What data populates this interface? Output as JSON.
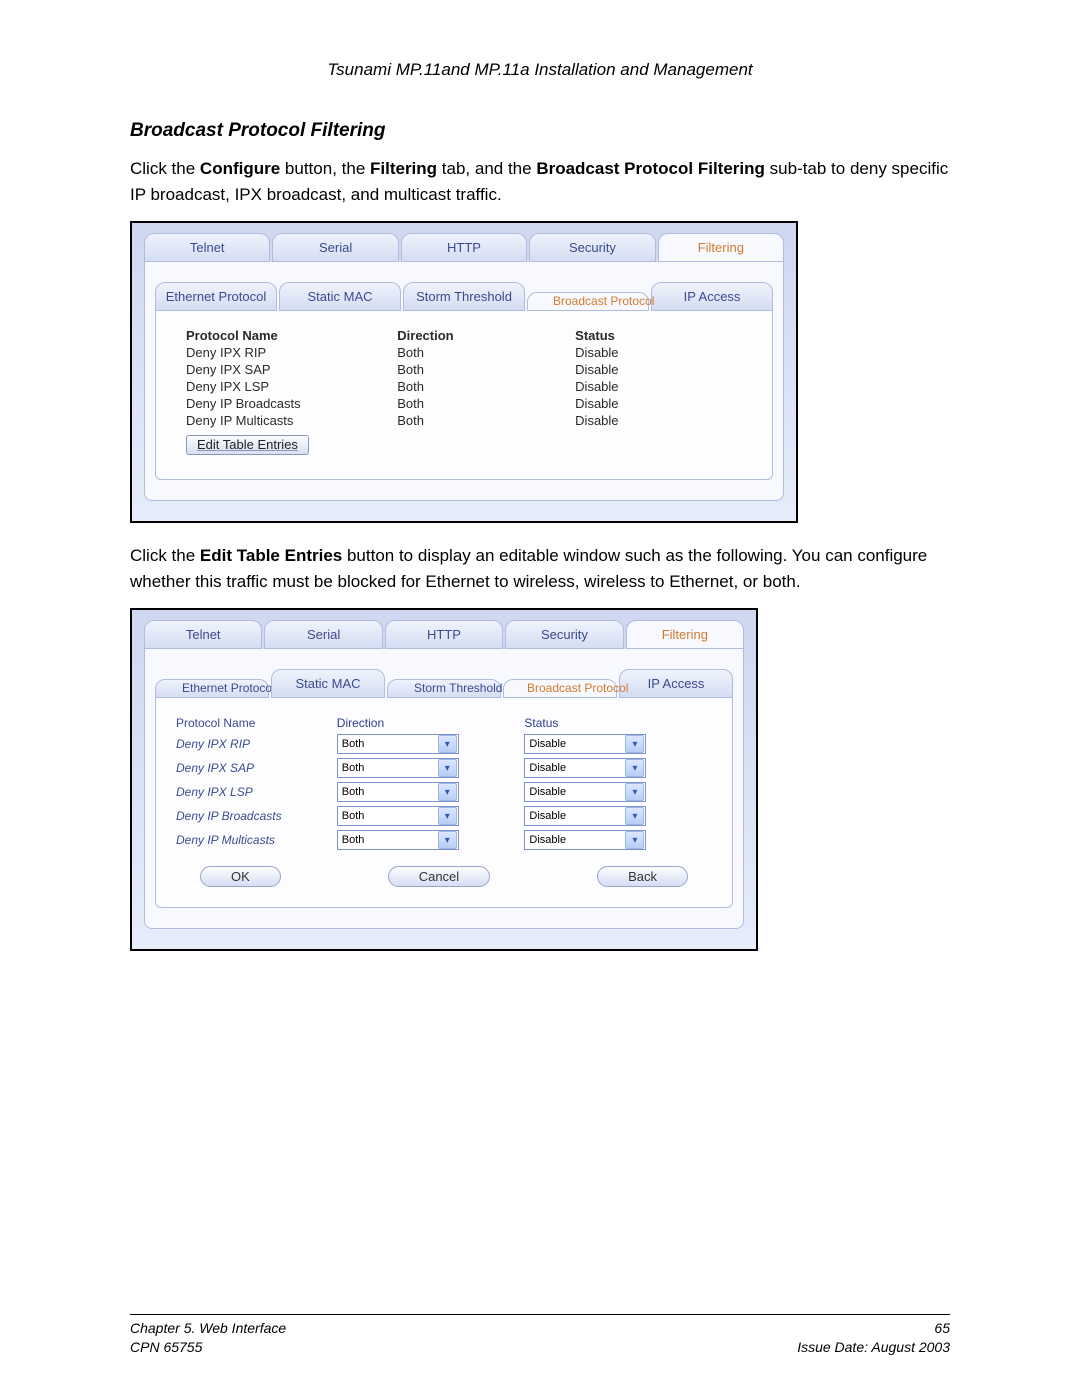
{
  "doc": {
    "header": "Tsunami MP.11and MP.11a Installation and Management",
    "section_title": "Broadcast Protocol Filtering",
    "para1_a": "Click the ",
    "para1_b": "Configure",
    "para1_c": " button, the ",
    "para1_d": "Filtering",
    "para1_e": " tab, and the ",
    "para1_f": "Broadcast Protocol Filtering",
    "para1_g": " sub-tab to deny specific IP broadcast, IPX broadcast, and multicast traffic.",
    "para2_a": "Click the ",
    "para2_b": "Edit Table Entries",
    "para2_c": " button to display an editable window such as the following.  You can configure whether this traffic must be blocked for Ethernet to wireless, wireless to Ethernet, or both."
  },
  "mainTabs": [
    "Telnet",
    "Serial",
    "HTTP",
    "Security",
    "Filtering"
  ],
  "subTabs1": [
    "Ethernet Protocol",
    "Static MAC",
    "Storm Threshold",
    "Broadcast Protocol",
    "IP Access"
  ],
  "subTabs2": [
    "Ethernet Protocol",
    "Static MAC",
    "Storm Threshold",
    "Broadcast Protocol",
    "IP Access"
  ],
  "table1": {
    "cols": [
      "Protocol Name",
      "Direction",
      "Status"
    ],
    "rows": [
      {
        "name": "Deny IPX RIP",
        "dir": "Both",
        "status": "Disable"
      },
      {
        "name": "Deny IPX SAP",
        "dir": "Both",
        "status": "Disable"
      },
      {
        "name": "Deny IPX LSP",
        "dir": "Both",
        "status": "Disable"
      },
      {
        "name": "Deny IP Broadcasts",
        "dir": "Both",
        "status": "Disable"
      },
      {
        "name": "Deny IP Multicasts",
        "dir": "Both",
        "status": "Disable"
      }
    ],
    "edit_btn": "Edit Table Entries"
  },
  "table2": {
    "cols": [
      "Protocol Name",
      "Direction",
      "Status"
    ],
    "rows": [
      {
        "name": "Deny IPX RIP",
        "dir": "Both",
        "status": "Disable"
      },
      {
        "name": "Deny IPX SAP",
        "dir": "Both",
        "status": "Disable"
      },
      {
        "name": "Deny IPX LSP",
        "dir": "Both",
        "status": "Disable"
      },
      {
        "name": "Deny IP Broadcasts",
        "dir": "Both",
        "status": "Disable"
      },
      {
        "name": "Deny IP Multicasts",
        "dir": "Both",
        "status": "Disable"
      }
    ],
    "buttons": {
      "ok": "OK",
      "cancel": "Cancel",
      "back": "Back"
    }
  },
  "footer": {
    "chapter": "Chapter 5.  Web Interface",
    "cpn": "CPN 65755",
    "page": "65",
    "issue": "Issue Date:  August 2003"
  }
}
